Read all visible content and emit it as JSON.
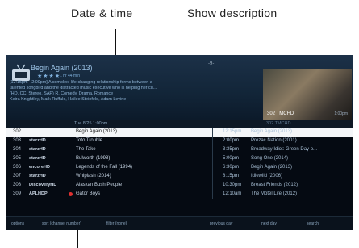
{
  "callouts": {
    "date_time": "Date & time",
    "show_description": "Show description"
  },
  "info": {
    "title": "Begin Again (2013)",
    "stars": "★★★★",
    "rating": "1 hr 44 min",
    "description": [
      "[12:15pm - 2:00pm] A complex, life-changing relationship forms between a",
      "talented songbird and the distracted music executive who is helping her cu...",
      "(HD, CC, Stereo, SAP) R, Comedy, Drama, Romance",
      "Keira Knightley, Mark Ruffalo, Hailee Steinfeld, Adam Levine"
    ],
    "channel_indicator": "-9-",
    "preview_label": "302 TMCHD",
    "now_time": "1:00pm"
  },
  "guide": {
    "date_left": "Tue 8/25   1:00pm",
    "date_right": "302 TMCHD",
    "rows": [
      {
        "num": "302",
        "logo": "",
        "title": "Begin Again (2013)",
        "time": "12:15pm",
        "show": "Begin Again (2013)",
        "selected": true
      },
      {
        "num": "303",
        "logo": "starzHD",
        "title": "Toto Trouble",
        "time": "2:00pm",
        "show": "Prozac Nation (2001)"
      },
      {
        "num": "304",
        "logo": "starzHD",
        "title": "The Take",
        "time": "3:35pm",
        "show": "Broadway Idiot: Green Day o..."
      },
      {
        "num": "305",
        "logo": "starzHD",
        "title": "Bulworth (1998)",
        "time": "5:00pm",
        "show": "Song One (2014)"
      },
      {
        "num": "306",
        "logo": "encoreHD",
        "title": "Legends of the Fall (1994)",
        "time": "6:30pm",
        "show": "Begin Again (2013)"
      },
      {
        "num": "307",
        "logo": "starzHD",
        "title": "Whiplash (2014)",
        "time": "8:15pm",
        "show": "Idlewild (2006)"
      },
      {
        "num": "308",
        "logo": "DiscoveryHD",
        "title": "Alaskan Bush People",
        "time": "10:30pm",
        "show": "Breast Friends (2012)"
      },
      {
        "num": "309",
        "logo": "APLHDP",
        "title": "Gator Boys",
        "time": "12:10am",
        "show": "The Motel Life (2012)"
      }
    ]
  },
  "footer": {
    "options": "options",
    "sort": "sort (channel number)",
    "filter": "filter (none)",
    "prev_day": "previous day",
    "next_day": "next day",
    "search": "search"
  }
}
